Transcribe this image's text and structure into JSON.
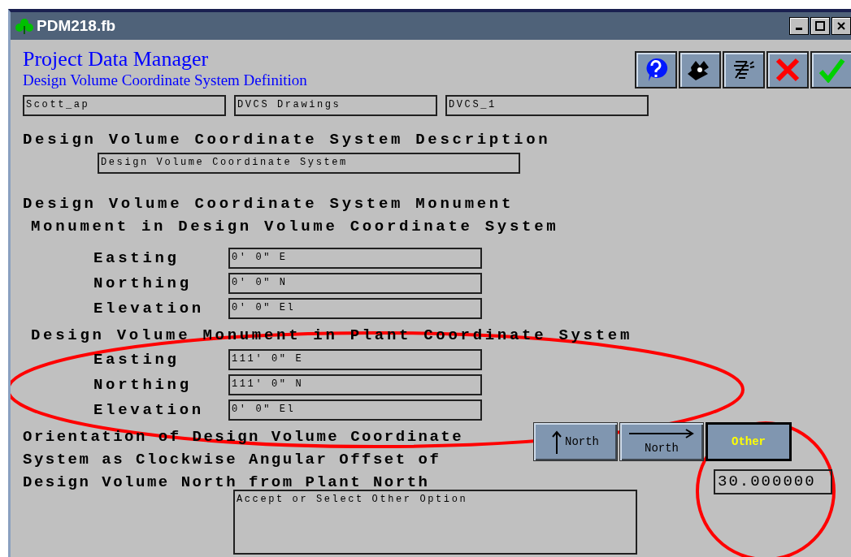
{
  "window": {
    "title": "PDM218.fb"
  },
  "header": {
    "title": "Project Data Manager",
    "subtitle": "Design Volume Coordinate System Definition"
  },
  "toolbar": [
    {
      "kind": "help"
    },
    {
      "kind": "hand"
    },
    {
      "kind": "wind"
    },
    {
      "kind": "cancel"
    },
    {
      "kind": "accept"
    }
  ],
  "context_fields": [
    "Scott_ap",
    "DVCS Drawings",
    "DVCS_1"
  ],
  "description": {
    "heading": "Design Volume Coordinate System Description",
    "value": "Design Volume Coordinate System"
  },
  "monument": {
    "heading": "Design Volume Coordinate System Monument",
    "groups": [
      {
        "heading": "Monument in Design Volume Coordinate System",
        "rows": [
          {
            "label": "Easting",
            "value": "0' 0\" E"
          },
          {
            "label": "Northing",
            "value": "0' 0\" N"
          },
          {
            "label": "Elevation",
            "value": "0' 0\" El"
          }
        ]
      },
      {
        "heading": "Design Volume Monument in Plant Coordinate System",
        "rows": [
          {
            "label": "Easting",
            "value": "111' 0\" E"
          },
          {
            "label": "Northing",
            "value": "111' 0\" N"
          },
          {
            "label": "Elevation",
            "value": "0' 0\" El"
          }
        ]
      }
    ]
  },
  "orientation": {
    "lines": [
      "Orientation of Design Volume Coordinate",
      "System as Clockwise Angular Offset of",
      "Design Volume North from Plant North"
    ],
    "options": [
      {
        "kind": "up",
        "label": "North",
        "selected": false
      },
      {
        "kind": "right",
        "label": "North",
        "selected": false
      },
      {
        "kind": "text",
        "label": "Other",
        "selected": true
      }
    ],
    "value": "30.000000"
  },
  "message": "Accept or Select Other Option"
}
